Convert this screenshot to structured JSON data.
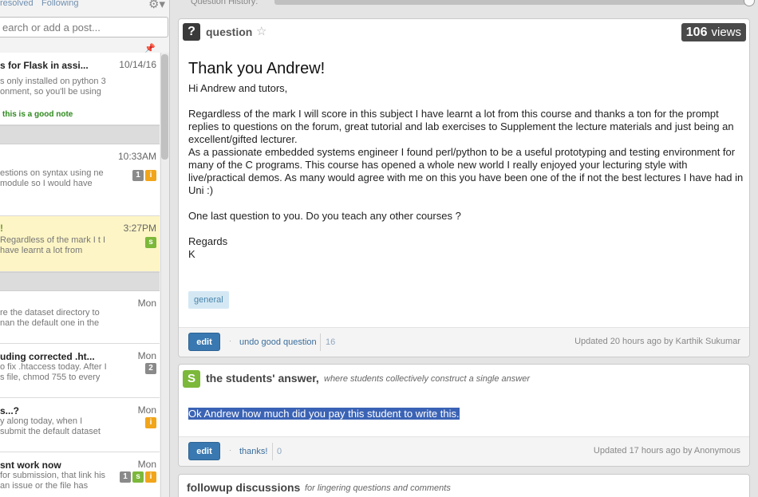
{
  "filters": {
    "unresolved": "resolved",
    "following": "Following"
  },
  "search": {
    "placeholder": "earch or add a post..."
  },
  "history": {
    "label": "Question History:"
  },
  "feed": {
    "items": [
      {
        "title": "s for Flask in assi...",
        "date": "10/14/16",
        "snippet": "s only installed on python 3 onment, so you'll be using",
        "note": "this is a good note",
        "badges": [
          "note"
        ]
      },
      {
        "title": "",
        "date": "10:33AM",
        "snippet": "estions on syntax using ne module so I would have",
        "badges": [
          "1",
          "i"
        ]
      },
      {
        "title": "!",
        "date": "3:27PM",
        "snippet": "Regardless of the mark I t I have learnt a lot from",
        "badges": [
          "s"
        ]
      },
      {
        "title": "",
        "date": "Mon",
        "snippet": "re the dataset directory to nan the default one in the",
        "badges": [
          "note"
        ]
      },
      {
        "title": "uding corrected .ht...",
        "date": "Mon",
        "snippet": "o fix .htaccess today. After I s file, chmod 755 to every",
        "badges": [
          "2",
          "note"
        ]
      },
      {
        "title": "s...?",
        "date": "Mon",
        "snippet": "y along today, when I submit the default dataset",
        "badges": [
          "i"
        ]
      },
      {
        "title": "snt work now",
        "date": "Mon",
        "snippet": "for submission, that link his an issue or the file has",
        "badges": [
          "1",
          "s",
          "i"
        ]
      }
    ]
  },
  "question": {
    "label": "question",
    "views_count": "106",
    "views_word": "views",
    "title": "Thank you Andrew!",
    "greeting": "Hi Andrew and tutors,",
    "para1": "Regardless of the mark I will score in this subject I have learnt a lot from this course and thanks a ton for the prompt replies to questions on the forum, great tutorial and lab exercises to Supplement the lecture materials and just being an excellent/gifted lecturer.",
    "para2": "As a passionate embedded systems engineer I found perl/python to be a useful prototyping and testing environment for many of the C programs. This course has opened a whole new world I really enjoyed your lecturing style with live/practical demos. As many would agree with me on this you have been one of the if not the best lectures I have had in Uni :)",
    "para3": "One last question to you. Do you teach any other courses ?",
    "sign1": "Regards",
    "sign2": "K",
    "tag": "general",
    "edit": "edit",
    "action": "undo good question",
    "count": "16",
    "updated": "Updated 20 hours ago by Karthik Sukumar"
  },
  "answer": {
    "icon_letter": "S",
    "label": "the students' answer,",
    "sub": "where students collectively construct a single answer",
    "text": "Ok Andrew how much did you pay this student to write this.",
    "edit": "edit",
    "action": "thanks!",
    "count": "0",
    "updated": "Updated 17 hours ago by Anonymous"
  },
  "followup": {
    "title": "followup discussions",
    "sub": "for lingering questions and comments"
  },
  "colors": {
    "accent": "#3978b0",
    "student_green": "#7cb83a",
    "instructor_orange": "#f1a51a",
    "selected_row": "#fdf5c5"
  }
}
